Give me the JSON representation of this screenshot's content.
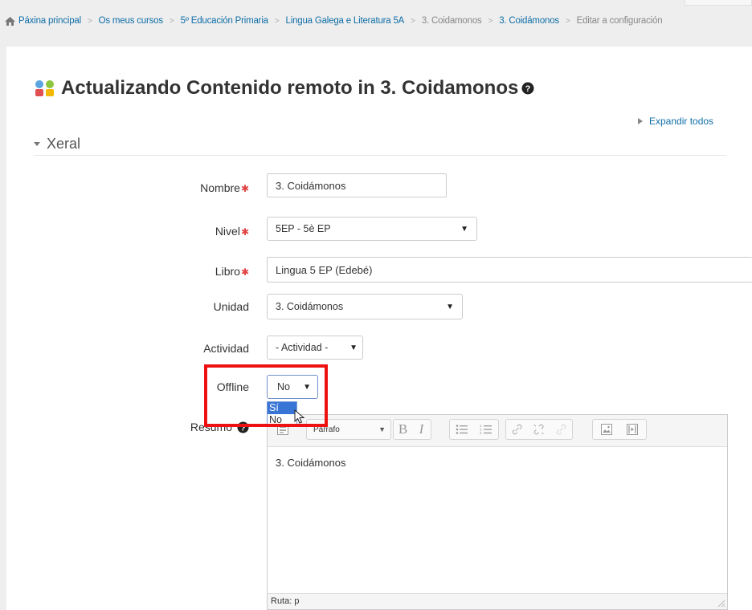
{
  "breadcrumb": [
    {
      "label": "Páxina principal",
      "link": true
    },
    {
      "label": "Os meus cursos",
      "link": true
    },
    {
      "label": "5º Educación Primaria",
      "link": true
    },
    {
      "label": "Lingua Galega e Literatura 5A",
      "link": true
    },
    {
      "label": "3. Coidamonos",
      "link": false
    },
    {
      "label": "3. Coidámonos",
      "link": true
    },
    {
      "label": "Editar a configuración",
      "link": false
    }
  ],
  "page": {
    "title": "Actualizando Contenido remoto in 3. Coidamonos",
    "expand_all": "Expandir todos",
    "section": "Xeral"
  },
  "form": {
    "nombre": {
      "label": "Nombre",
      "value": "3. Coidámonos",
      "required": true
    },
    "nivel": {
      "label": "Nivel",
      "value": "5EP - 5è EP",
      "required": true
    },
    "libro": {
      "label": "Libro",
      "value": "Lingua 5 EP (Edebé)",
      "required": true
    },
    "unidad": {
      "label": "Unidad",
      "value": "3. Coidámonos"
    },
    "actividad": {
      "label": "Actividad",
      "value": "- Actividad -"
    },
    "offline": {
      "label": "Offline",
      "value": "No",
      "options": [
        "Sí",
        "No"
      ],
      "highlighted": "Sí"
    },
    "resumo": {
      "label": "Resumo"
    }
  },
  "editor": {
    "format": "Párrafo",
    "bold": "B",
    "italic": "I",
    "content": "3. Coidámonos",
    "path": "Ruta: p"
  },
  "colors": {
    "link": "#0f6ea8",
    "required": "#e04343",
    "highlight": "#3875d7",
    "annotation": "#ee1111"
  },
  "icons": [
    "home-icon",
    "module-icon",
    "help-icon",
    "required-star-icon",
    "unordered-list-icon",
    "ordered-list-icon",
    "link-icon",
    "unlink-icon",
    "anchor-icon",
    "image-icon",
    "media-icon",
    "mouse-cursor-icon"
  ]
}
